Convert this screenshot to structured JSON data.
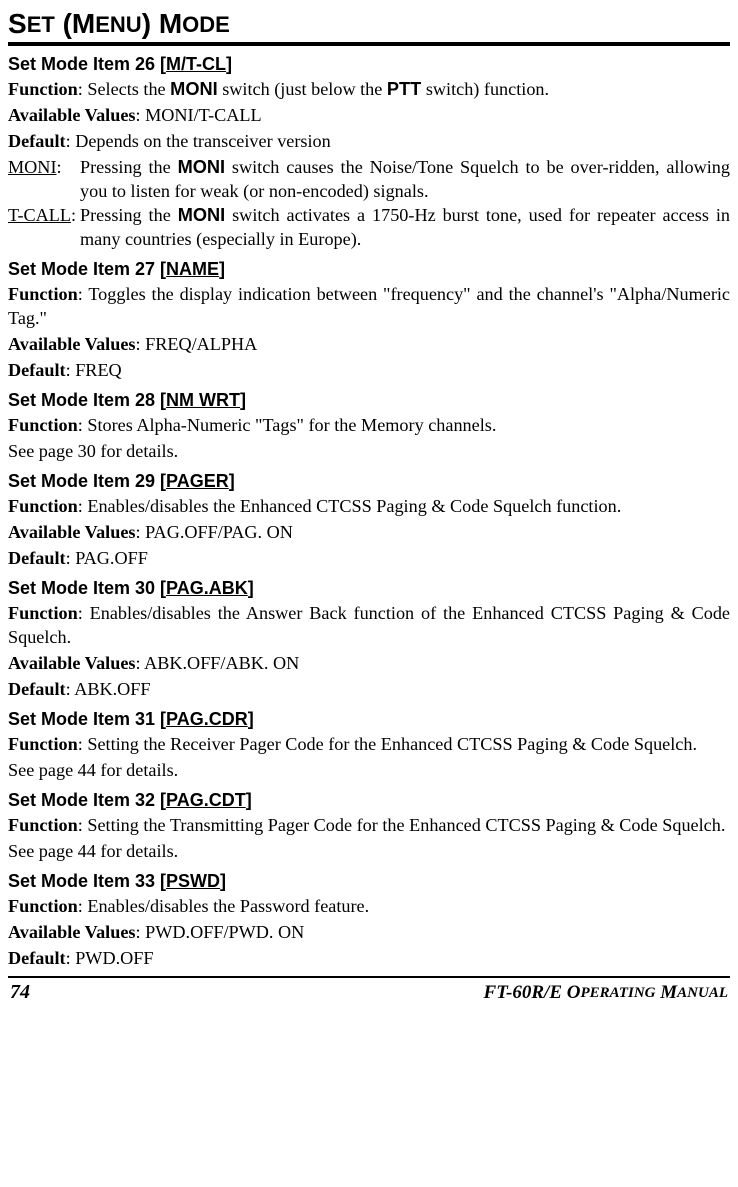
{
  "title": {
    "s": "S",
    "et": "ET",
    "open": " (",
    "m": "M",
    "enu": "ENU",
    "close": ") ",
    "m2": "M",
    "ode": "ODE"
  },
  "item26": {
    "heading_prefix": "Set Mode Item 26 [",
    "code": "M/T-CL",
    "heading_suffix": "]",
    "func_label": "Function",
    "func_text_a": ": Selects the ",
    "moni": "MONI",
    "func_text_b": " switch (just below the ",
    "ptt": "PTT",
    "func_text_c": " switch) function.",
    "avail_label": "Available Values",
    "avail_text": ": MONI/T-CALL",
    "default_label": "Default",
    "default_text": ": Depends on the transceiver version",
    "moni_label": "MONI",
    "moni_colon": ":",
    "moni_desc_a": "Pressing the ",
    "moni_desc_b": " switch causes the Noise/Tone Squelch to be over-ridden, allowing you to listen for weak (or non-encoded) signals.",
    "tcall_label": "T-CALL",
    "tcall_colon": ":",
    "tcall_desc_a": "Pressing the ",
    "tcall_desc_b": " switch activates a 1750-Hz burst tone, used for repeater access in many countries (especially in Europe)."
  },
  "item27": {
    "heading_prefix": "Set Mode Item 27 [",
    "code": "NAME",
    "heading_suffix": "]",
    "func_label": "Function",
    "func_text": ": Toggles the display indication between \"frequency\" and the channel's \"Alpha/Numeric Tag.\"",
    "avail_label": "Available Values",
    "avail_text": ": FREQ/ALPHA",
    "default_label": "Default",
    "default_text": ": FREQ"
  },
  "item28": {
    "heading_prefix": "Set Mode Item 28 [",
    "code": "NM WRT",
    "heading_suffix": "]",
    "func_label": "Function",
    "func_text": ": Stores Alpha-Numeric \"Tags\" for the Memory channels.",
    "see": "See page 30 for details."
  },
  "item29": {
    "heading_prefix": "Set Mode Item 29 [",
    "code": "PAGER",
    "heading_suffix": "]",
    "func_label": "Function",
    "func_text": ": Enables/disables the Enhanced CTCSS Paging & Code Squelch function.",
    "avail_label": "Available Values",
    "avail_text": ": PAG.OFF/PAG. ON",
    "default_label": "Default",
    "default_text": ": PAG.OFF"
  },
  "item30": {
    "heading_prefix": "Set Mode Item 30 [",
    "code": "PAG.ABK",
    "heading_suffix": "]",
    "func_label": "Function",
    "func_text": ": Enables/disables the Answer Back function of the Enhanced CTCSS Paging & Code Squelch.",
    "avail_label": "Available Values",
    "avail_text": ": ABK.OFF/ABK. ON",
    "default_label": "Default",
    "default_text": ": ABK.OFF"
  },
  "item31": {
    "heading_prefix": "Set Mode Item 31 [",
    "code": "PAG.CDR",
    "heading_suffix": "]",
    "func_label": "Function",
    "func_text": ": Setting the Receiver Pager Code for the Enhanced CTCSS Paging & Code Squelch.",
    "see": "See page 44 for details."
  },
  "item32": {
    "heading_prefix": "Set Mode Item 32 [",
    "code": "PAG.CDT",
    "heading_suffix": "]",
    "func_label": "Function",
    "func_text": ": Setting the Transmitting Pager Code for the Enhanced CTCSS Paging & Code Squelch.",
    "see": "See page 44 for details."
  },
  "item33": {
    "heading_prefix": "Set Mode Item 33 [",
    "code": "PSWD",
    "heading_suffix": "]",
    "func_label": "Function",
    "func_text": ": Enables/disables the Password feature.",
    "avail_label": "Available Values",
    "avail_text": ": PWD.OFF/PWD. ON",
    "default_label": "Default",
    "default_text": ": PWD.OFF"
  },
  "footer": {
    "page": "74",
    "manual_a": "FT-60R/E O",
    "manual_b": "PERATING",
    "manual_c": " M",
    "manual_d": "ANUAL"
  }
}
